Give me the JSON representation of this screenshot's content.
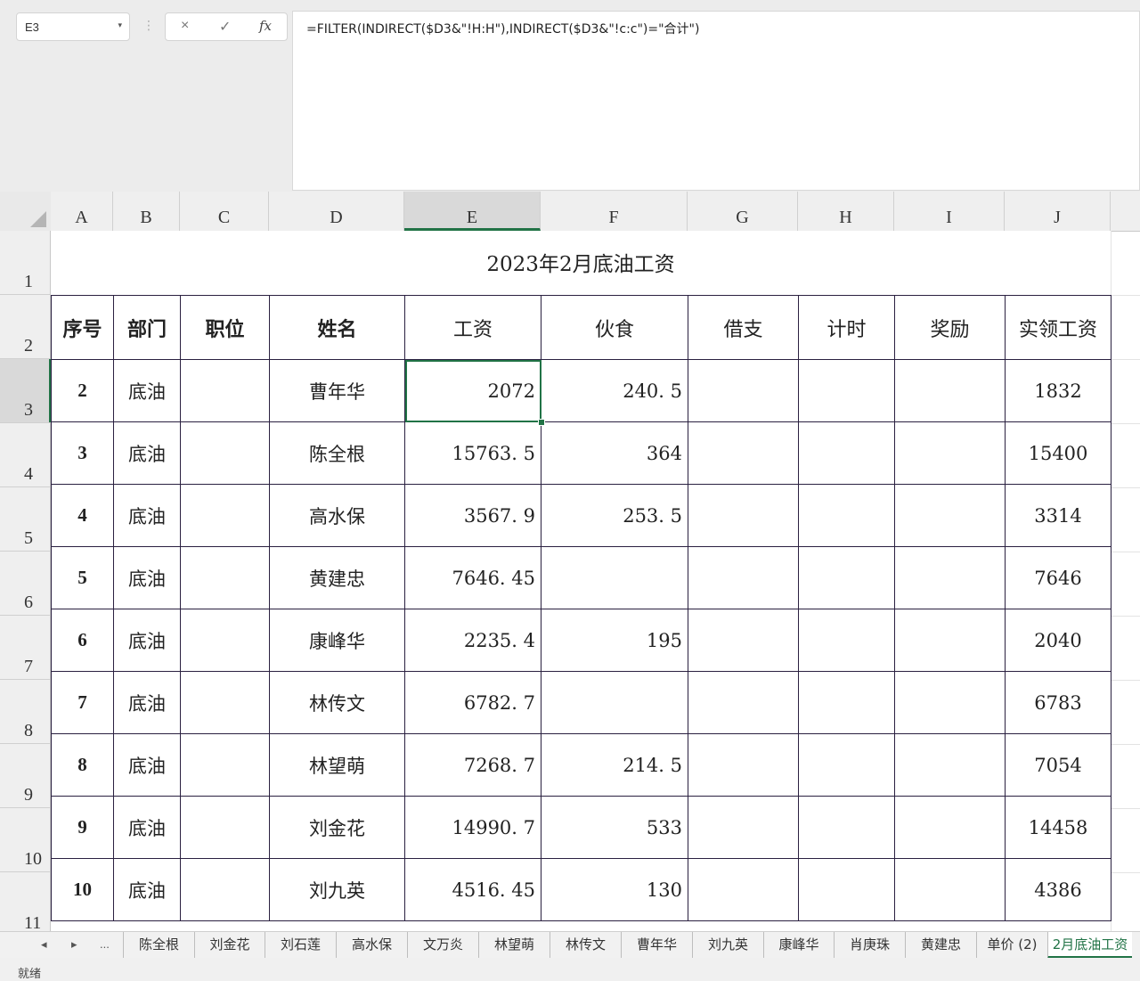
{
  "formula_bar": {
    "name_box": "E3",
    "dropdown_icon": "▾",
    "sep": "⋮",
    "cancel": "×",
    "confirm": "✓",
    "fx": "fx",
    "formula": "=FILTER(INDIRECT($D3&\"!H:H\"),INDIRECT($D3&\"!c:c\")=\"合计\")"
  },
  "columns": [
    "A",
    "B",
    "C",
    "D",
    "E",
    "F",
    "G",
    "H",
    "I",
    "J"
  ],
  "rows": [
    "1",
    "2",
    "3",
    "4",
    "5",
    "6",
    "7",
    "8",
    "9",
    "10",
    "11"
  ],
  "title": "2023年2月底油工资",
  "headers": [
    "序号",
    "部门",
    "职位",
    "姓名",
    "工资",
    "伙食",
    "借支",
    "计时",
    "奖励",
    "实领工资"
  ],
  "data": [
    {
      "seq": "2",
      "dept": "底油",
      "pos": "",
      "name": "曹年华",
      "wage": "2072",
      "food": "240. 5",
      "loan": "",
      "hours": "",
      "bonus": "",
      "net": "1832"
    },
    {
      "seq": "3",
      "dept": "底油",
      "pos": "",
      "name": "陈全根",
      "wage": "15763. 5",
      "food": "364",
      "loan": "",
      "hours": "",
      "bonus": "",
      "net": "15400"
    },
    {
      "seq": "4",
      "dept": "底油",
      "pos": "",
      "name": "高水保",
      "wage": "3567. 9",
      "food": "253. 5",
      "loan": "",
      "hours": "",
      "bonus": "",
      "net": "3314"
    },
    {
      "seq": "5",
      "dept": "底油",
      "pos": "",
      "name": "黄建忠",
      "wage": "7646. 45",
      "food": "",
      "loan": "",
      "hours": "",
      "bonus": "",
      "net": "7646"
    },
    {
      "seq": "6",
      "dept": "底油",
      "pos": "",
      "name": "康峰华",
      "wage": "2235. 4",
      "food": "195",
      "loan": "",
      "hours": "",
      "bonus": "",
      "net": "2040"
    },
    {
      "seq": "7",
      "dept": "底油",
      "pos": "",
      "name": "林传文",
      "wage": "6782. 7",
      "food": "",
      "loan": "",
      "hours": "",
      "bonus": "",
      "net": "6783"
    },
    {
      "seq": "8",
      "dept": "底油",
      "pos": "",
      "name": "林望萌",
      "wage": "7268. 7",
      "food": "214. 5",
      "loan": "",
      "hours": "",
      "bonus": "",
      "net": "7054"
    },
    {
      "seq": "9",
      "dept": "底油",
      "pos": "",
      "name": "刘金花",
      "wage": "14990. 7",
      "food": "533",
      "loan": "",
      "hours": "",
      "bonus": "",
      "net": "14458"
    },
    {
      "seq": "10",
      "dept": "底油",
      "pos": "",
      "name": "刘九英",
      "wage": "4516. 45",
      "food": "130",
      "loan": "",
      "hours": "",
      "bonus": "",
      "net": "4386"
    }
  ],
  "tab_nav": {
    "first": "◂",
    "prev": "▸",
    "more": "..."
  },
  "sheet_tabs": [
    "陈全根",
    "刘金花",
    "刘石莲",
    "高水保",
    "文万炎",
    "林望萌",
    "林传文",
    "曹年华",
    "刘九英",
    "康峰华",
    "肖庚珠",
    "黄建忠",
    "单价 (2)",
    "2月底油工资"
  ],
  "status": "就绪"
}
